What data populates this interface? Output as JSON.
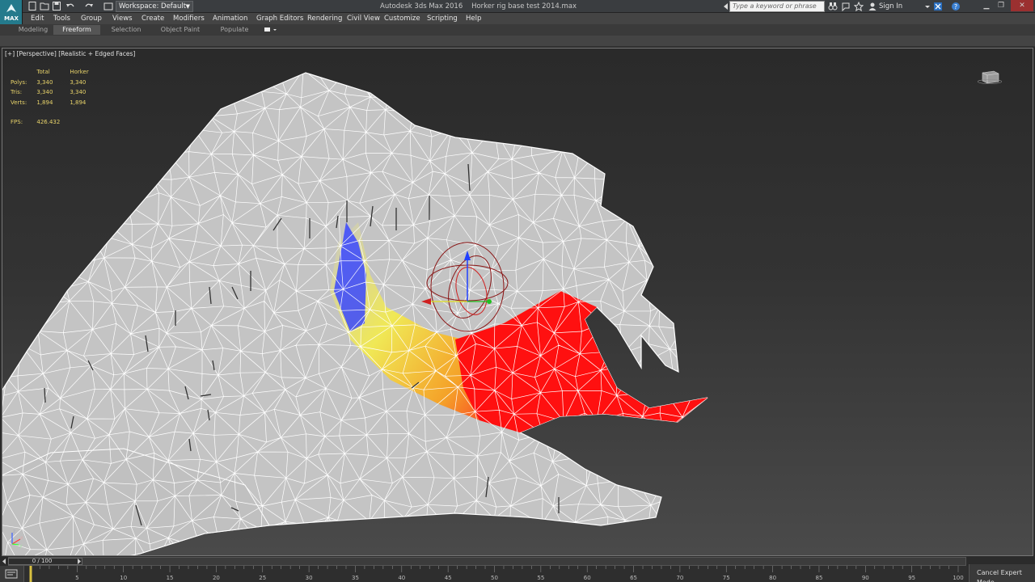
{
  "app": {
    "logo_label": "MAX",
    "title": "Autodesk 3ds Max 2016",
    "file": "Horker rig base test 2014.max"
  },
  "workspace": {
    "label": "Workspace: Default"
  },
  "search": {
    "placeholder": "Type a keyword or phrase"
  },
  "account": {
    "signin": "Sign In"
  },
  "menu": [
    "Edit",
    "Tools",
    "Group",
    "Views",
    "Create",
    "Modifiers",
    "Animation",
    "Graph Editors",
    "Rendering",
    "Civil View",
    "Customize",
    "Scripting",
    "Help"
  ],
  "ribbon": {
    "tabs": [
      "Modeling",
      "Freeform",
      "Selection",
      "Object Paint",
      "Populate"
    ],
    "active": "Freeform"
  },
  "viewport": {
    "label": "[+] [Perspective] [Realistic + Edged Faces]",
    "stats": {
      "headers": [
        "",
        "Total",
        "Horker"
      ],
      "rows": [
        [
          "Polys:",
          "3,340",
          "3,340"
        ],
        [
          "Tris:",
          "3,340",
          "3,340"
        ],
        [
          "Verts:",
          "1,894",
          "1,894"
        ]
      ],
      "fps_label": "FPS:",
      "fps_value": "426.432"
    },
    "axis": {
      "x": "x",
      "y": "y",
      "z": "z"
    }
  },
  "timeline": {
    "position": "0 / 100",
    "frame": 0,
    "total": 100,
    "ticks": [
      0,
      5,
      10,
      15,
      20,
      25,
      30,
      35,
      40,
      45,
      50,
      55,
      60,
      65,
      70,
      75,
      80,
      85,
      90,
      95,
      100
    ]
  },
  "status": {
    "cancel_expert": "Cancel Expert Mode"
  },
  "colors": {
    "accent": "#247a8c",
    "weight_red": "#ff1010",
    "weight_yellow": "#fff020",
    "weight_blue": "#3040ff",
    "mesh": "#c8c8c8"
  }
}
